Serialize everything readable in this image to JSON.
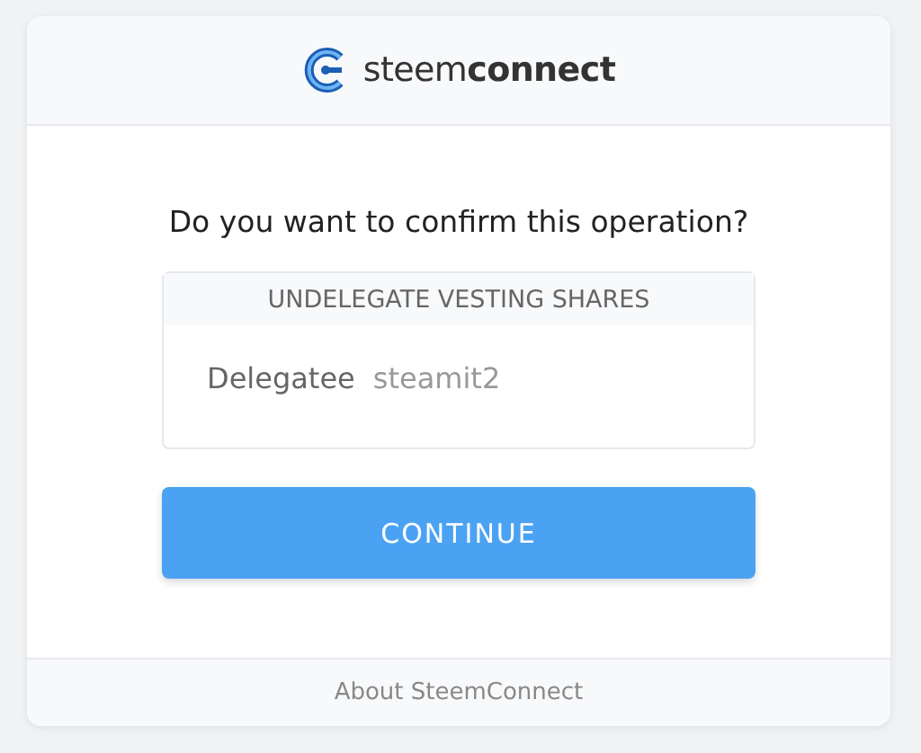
{
  "header": {
    "logo_text": "steem**connect**"
  },
  "question": "Do you want to confirm this operation?",
  "operation": {
    "title": "UNDELEGATE VESTING SHARES",
    "fields": [
      {
        "label": "Delegatee",
        "value": "steamit2"
      }
    ]
  },
  "button": "CONTINUE",
  "footer": {
    "link": "About SteemConnect"
  }
}
